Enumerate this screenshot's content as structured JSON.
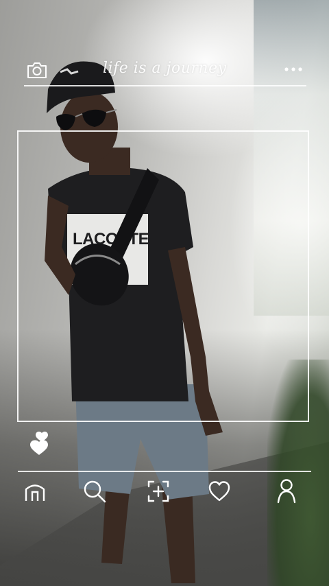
{
  "header": {
    "camera_icon": "camera-icon",
    "caption": "life is a journey",
    "more_icon": "more-dots-icon"
  },
  "photo": {
    "shirt_text": "LACOSTE"
  },
  "actions": {
    "like_icon": "hearts-icon"
  },
  "bottom_nav": {
    "items": [
      {
        "icon": "home-icon"
      },
      {
        "icon": "search-icon"
      },
      {
        "icon": "add-post-icon"
      },
      {
        "icon": "heart-icon"
      },
      {
        "icon": "profile-icon"
      }
    ]
  },
  "colors": {
    "overlay": "#ffffff"
  }
}
